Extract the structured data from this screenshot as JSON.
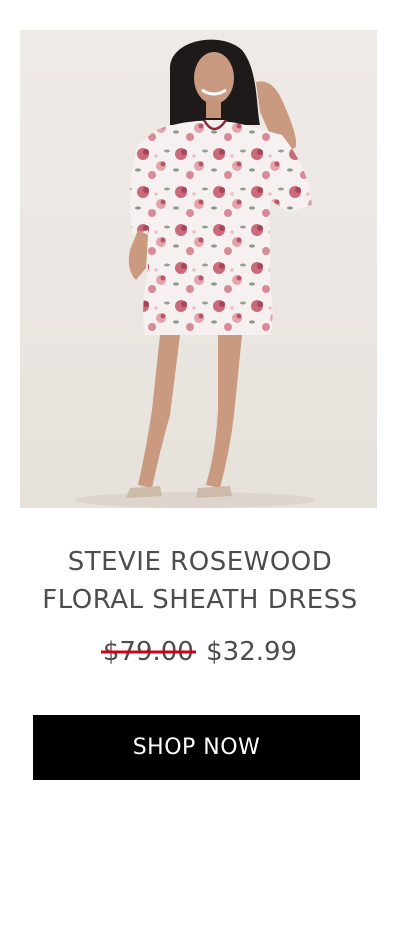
{
  "product": {
    "title_line1": "STEVIE ROSEWOOD",
    "title_line2": "FLORAL SHEATH DRESS",
    "price_original": "$79.00",
    "price_sale": "$32.99"
  },
  "cta": {
    "label": "SHOP NOW"
  },
  "colors": {
    "background": "#ffffff",
    "button_bg": "#000000",
    "button_text": "#ffffff",
    "strike": "#d0021b",
    "text": "#4d4d4d"
  }
}
